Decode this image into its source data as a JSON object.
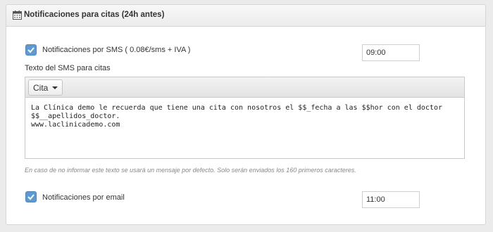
{
  "panel": {
    "title": "Notificaciones para citas (24h antes)",
    "icon": "calendar-icon"
  },
  "sms": {
    "checked": true,
    "label": "Notificaciones por SMS ( 0.08€/sms + IVA )",
    "time": "09:00"
  },
  "sms_text": {
    "label": "Texto del SMS para citas",
    "dropdown_label": "Cita",
    "body": "La Clínica demo le recuerda que tiene una cita con nosotros el $$_fecha a las $$hor con el doctor $$__apellidos_doctor.\nwww.laclinicademo.com",
    "help": "En caso de no informar este texto se usará un mensaje por defecto. Solo serán enviados los 160 primeros caracteres."
  },
  "email": {
    "checked": true,
    "label": "Notificaciones por email",
    "time": "11:00"
  },
  "colors": {
    "checkbox": "#5b9bd5",
    "panel_border": "#d6d6d6",
    "background": "#ebebeb"
  }
}
